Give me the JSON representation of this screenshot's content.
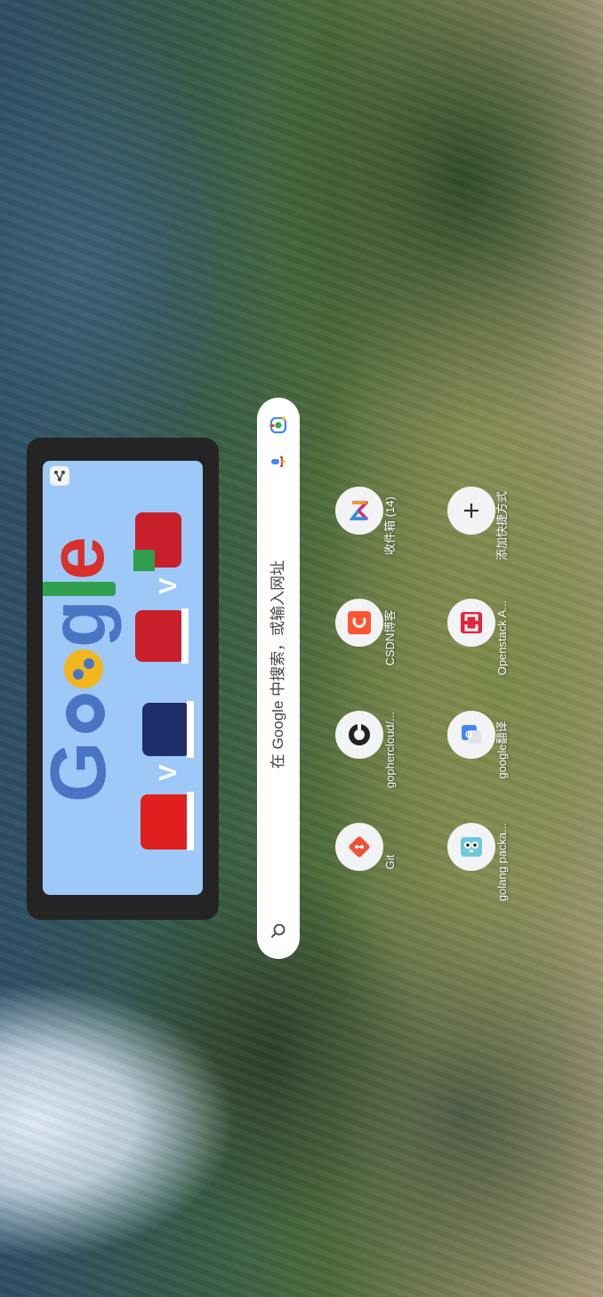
{
  "search": {
    "placeholder": "在 Google 中搜索，或输入网址"
  },
  "shortcuts_row1": [
    {
      "label": "收件箱 (14)",
      "icon": "sigma-icon"
    },
    {
      "label": "CSDN博客",
      "icon": "csdn-icon"
    },
    {
      "label": "gophercloud/...",
      "icon": "github-icon"
    },
    {
      "label": "Git",
      "icon": "git-icon"
    }
  ],
  "shortcuts_row2": [
    {
      "label": "添加快捷方式",
      "icon": "plus-icon"
    },
    {
      "label": "Openstack A...",
      "icon": "openstack-icon"
    },
    {
      "label": "google翻译",
      "icon": "translate-icon"
    },
    {
      "label": "golang packa...",
      "icon": "gopher-icon"
    }
  ],
  "colors": {
    "search_bg": "#ffffff",
    "doodle_bg": "#9dc8f7",
    "card_bg": "#242424"
  }
}
